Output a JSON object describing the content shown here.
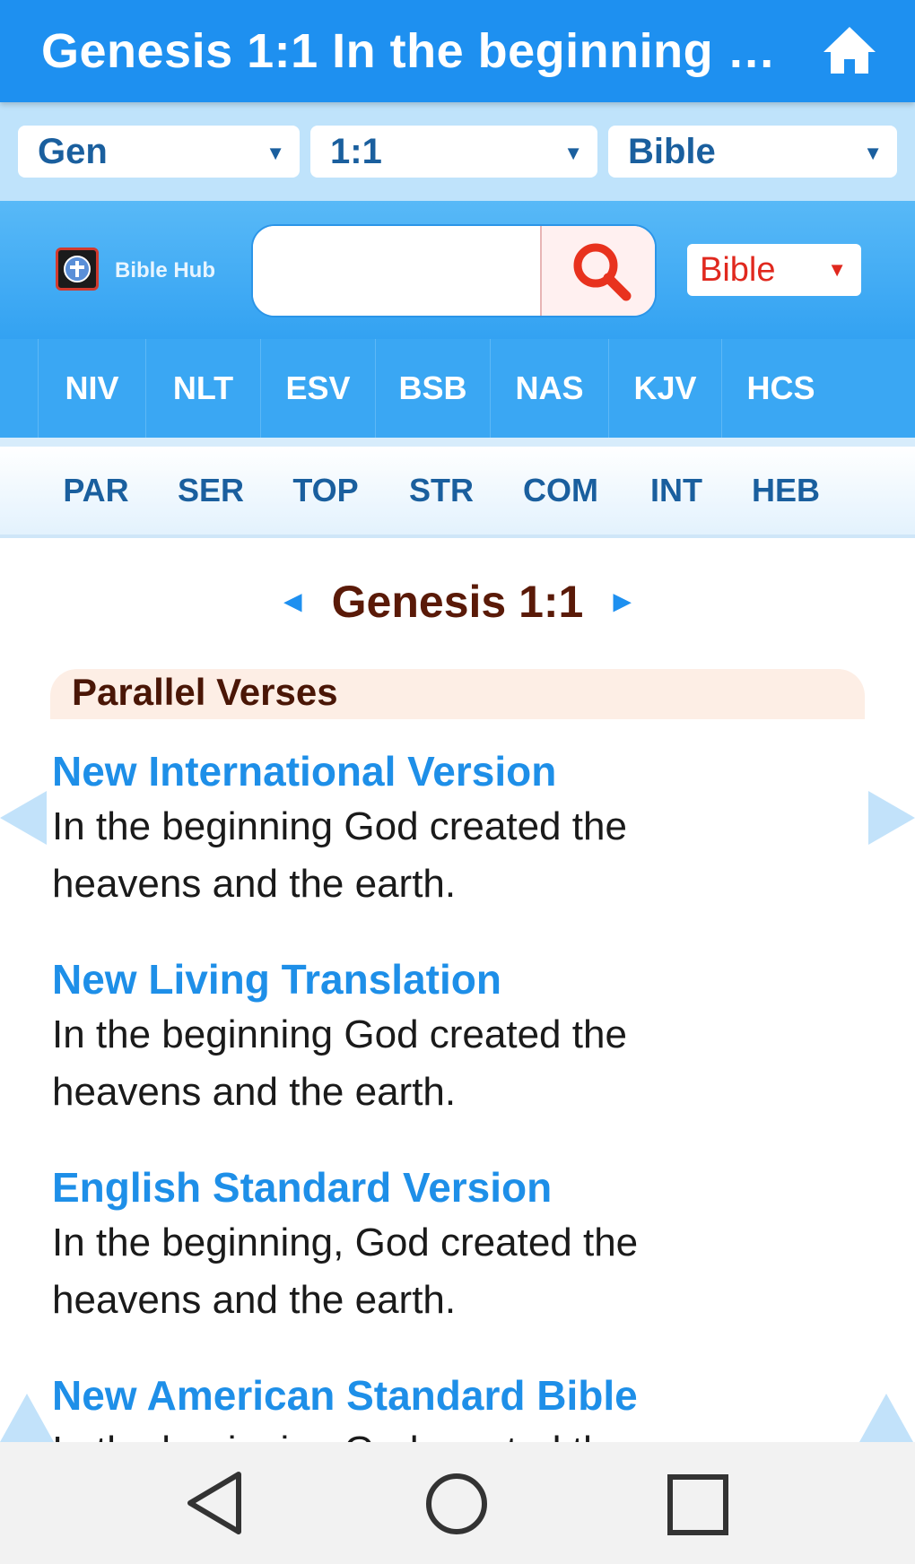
{
  "appbar": {
    "title": "Genesis 1:1 In the beginning G..."
  },
  "selectors": {
    "book": "Gen",
    "verse": "1:1",
    "mode": "Bible"
  },
  "header": {
    "logo_text": "Bible Hub",
    "search_placeholder": "",
    "bible_select": "Bible"
  },
  "version_tabs": [
    "NIV",
    "NLT",
    "ESV",
    "BSB",
    "NAS",
    "KJV",
    "HCS"
  ],
  "study_tabs": [
    "PAR",
    "SER",
    "TOP",
    "STR",
    "COM",
    "INT",
    "HEB"
  ],
  "content": {
    "reference": "Genesis 1:1",
    "section_title": "Parallel Verses",
    "verses": [
      {
        "version": "New International Version",
        "line1": "In the beginning God created the",
        "line2": "heavens and the earth."
      },
      {
        "version": "New Living Translation",
        "line1": "In the beginning God created the",
        "line2": "heavens and the earth."
      },
      {
        "version": "English Standard Version",
        "line1": "In the beginning, God created the",
        "line2": "heavens and the earth."
      },
      {
        "version": "New American Standard Bible",
        "line1": "In the beginning God created the",
        "line2": ""
      }
    ]
  },
  "colors": {
    "primary": "#1e90f0",
    "accent_red": "#e0281e",
    "verse_title": "#1e8fe8",
    "reference": "#5a1a08"
  },
  "icons": [
    "home-icon",
    "dropdown-arrow-icon",
    "search-icon",
    "prev-arrow-icon",
    "next-arrow-icon",
    "back-nav-icon",
    "home-nav-icon",
    "recents-nav-icon"
  ]
}
